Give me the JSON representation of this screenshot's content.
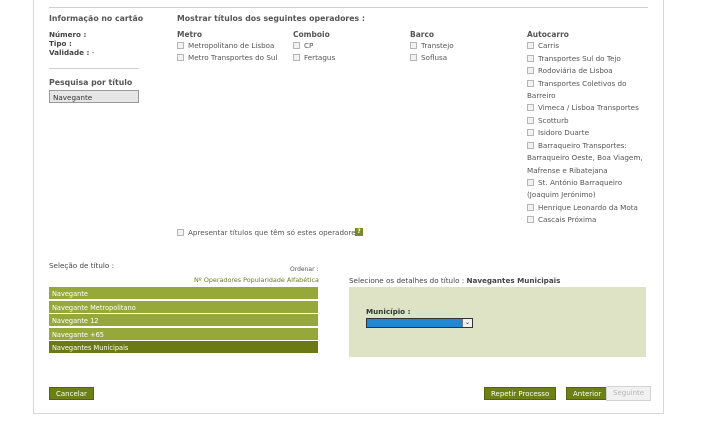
{
  "card_info": {
    "heading": "Informação no cartão",
    "number_label": "Número :",
    "type_label": "Tipo :",
    "validity_label": "Validade :",
    "validity_value": "-"
  },
  "search": {
    "heading": "Pesquisa por título",
    "value": "Navegante"
  },
  "operators": {
    "heading": "Mostrar títulos dos seguintes operadores :",
    "metro": {
      "title": "Metro",
      "items": [
        "Metropolitano de Lisboa",
        "Metro Transportes do Sul"
      ]
    },
    "comboio": {
      "title": "Comboio",
      "items": [
        "CP",
        "Fertagus"
      ]
    },
    "barco": {
      "title": "Barco",
      "items": [
        "Transtejo",
        "Soflusa"
      ]
    },
    "autocarro": {
      "title": "Autocarro",
      "items": [
        "Carris",
        "Transportes Sul do Tejo",
        "Rodoviária de Lisboa",
        "Transportes Coletivos do",
        "Vimeca / Lisboa Transportes",
        "Scotturb",
        "Isidoro Duarte",
        "Barraqueiro Transportes:",
        "St. António Barraqueiro",
        "Henrique Leonardo da Mota",
        "Cascais Próxima"
      ],
      "wrap": [
        "Barreiro",
        "Barraqueiro Oeste, Boa Viagem,",
        "Mafrense e Ribatejana",
        "(Joaquim Jerónimo)"
      ]
    },
    "only_these_label": "Apresentar títulos que têm só estes operadores",
    "help_glyph": "?"
  },
  "selection": {
    "heading": "Seleção de título :",
    "order_label": "Ordenar :",
    "order_options": "Nº Operadores Popularidade Alfabética",
    "titles": [
      "Navegante",
      "Navegante Metropolitano",
      "Navegante 12",
      "Navegante +65",
      "Navegantes Municipais"
    ],
    "selected_index": 4
  },
  "details": {
    "prefix": "Selecione os detalhes do título :",
    "title": "Navegantes Municipais",
    "municipio_label": "Município :",
    "municipio_value": "",
    "arrow_glyph": "⌄"
  },
  "buttons": {
    "cancel": "Cancelar",
    "repeat": "Repetir Processo",
    "previous": "Anterior",
    "next": "Seguinte"
  },
  "colors": {
    "accent": "#6d7f17",
    "list_item": "#97a83a",
    "panel": "#dfe3c6",
    "select": "#1f88d6"
  }
}
